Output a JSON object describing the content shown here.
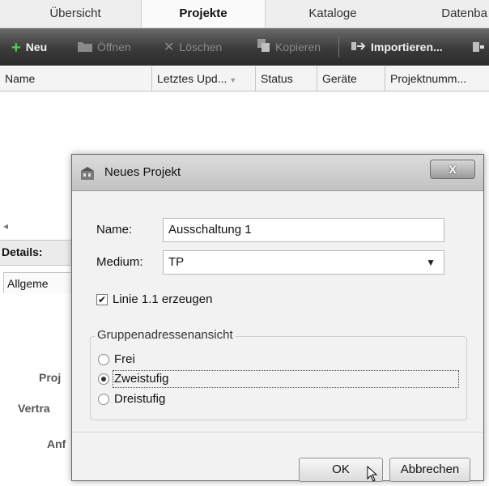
{
  "tabs": [
    {
      "label": "Übersicht"
    },
    {
      "label": "Projekte"
    },
    {
      "label": "Kataloge"
    },
    {
      "label": "Datenba"
    }
  ],
  "toolbar": {
    "new_label": "Neu",
    "open_label": "Öffnen",
    "delete_label": "Löschen",
    "copy_label": "Kopieren",
    "import_label": "Importieren..."
  },
  "table": {
    "columns": [
      "Name",
      "Letztes Upd...",
      "Status",
      "Geräte",
      "Projektnumm..."
    ]
  },
  "details": {
    "title": "Details:",
    "tab_label": "Allgeme",
    "fields": [
      "Proj",
      "Vertra",
      "Anf"
    ]
  },
  "dialog": {
    "title": "Neues Projekt",
    "close_label": "X",
    "name_label": "Name:",
    "name_value": "Ausschaltung 1",
    "medium_label": "Medium:",
    "medium_value": "TP",
    "create_line_label": "Linie 1.1 erzeugen",
    "create_line_checked": true,
    "group_title": "Gruppenadressenansicht",
    "group_options": [
      {
        "label": "Frei",
        "selected": false
      },
      {
        "label": "Zweistufig",
        "selected": true
      },
      {
        "label": "Dreistufig",
        "selected": false
      }
    ],
    "ok_label": "OK",
    "cancel_label": "Abbrechen"
  }
}
